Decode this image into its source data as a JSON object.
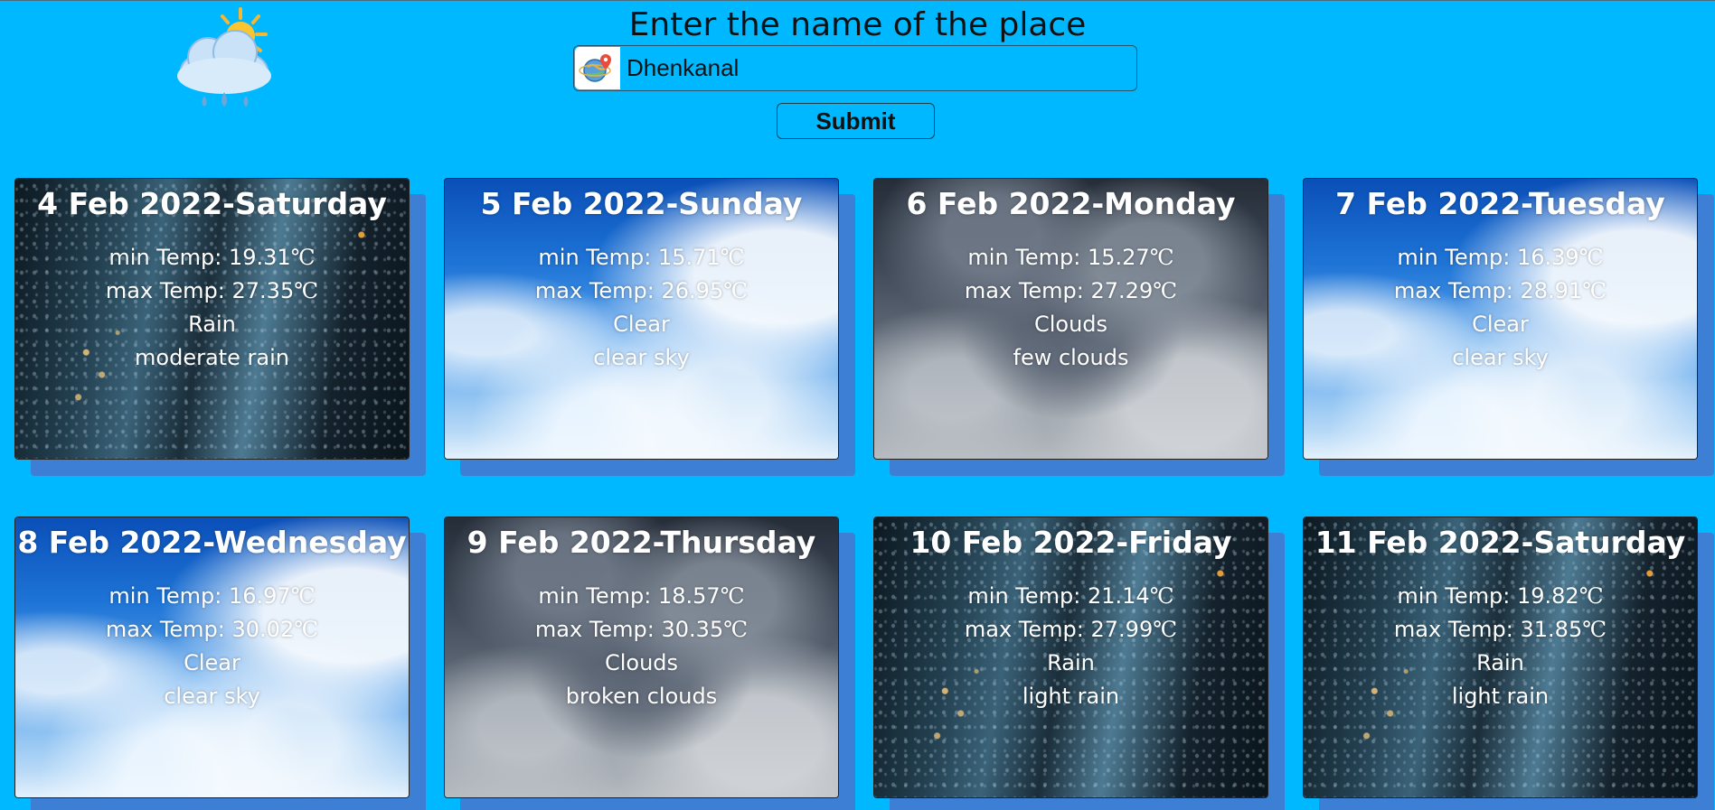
{
  "header": {
    "prompt": "Enter the name of the place",
    "search_value": "Dhenkanal",
    "submit_label": "Submit"
  },
  "labels": {
    "min_prefix": "min Temp: ",
    "max_prefix": "max Temp: ",
    "unit": "℃"
  },
  "colors": {
    "page_background": "#00b8ff",
    "card_shadow": "#3d7fd4"
  },
  "icons": {
    "logo": "sun-behind-rain-cloud-icon",
    "search": "globe-location-pin-icon"
  },
  "forecast": [
    {
      "date": "4 Feb 2022-Saturday",
      "min": "19.31",
      "max": "27.35",
      "main": "Rain",
      "description": "moderate rain",
      "background": "rain"
    },
    {
      "date": "5 Feb 2022-Sunday",
      "min": "15.71",
      "max": "26.95",
      "main": "Clear",
      "description": "clear sky",
      "background": "clear"
    },
    {
      "date": "6 Feb 2022-Monday",
      "min": "15.27",
      "max": "27.29",
      "main": "Clouds",
      "description": "few clouds",
      "background": "clouds"
    },
    {
      "date": "7 Feb 2022-Tuesday",
      "min": "16.39",
      "max": "28.91",
      "main": "Clear",
      "description": "clear sky",
      "background": "clear"
    },
    {
      "date": "8 Feb 2022-Wednesday",
      "min": "16.97",
      "max": "30.02",
      "main": "Clear",
      "description": "clear sky",
      "background": "clear"
    },
    {
      "date": "9 Feb 2022-Thursday",
      "min": "18.57",
      "max": "30.35",
      "main": "Clouds",
      "description": "broken clouds",
      "background": "clouds"
    },
    {
      "date": "10 Feb 2022-Friday",
      "min": "21.14",
      "max": "27.99",
      "main": "Rain",
      "description": "light rain",
      "background": "rain"
    },
    {
      "date": "11 Feb 2022-Saturday",
      "min": "19.82",
      "max": "31.85",
      "main": "Rain",
      "description": "light rain",
      "background": "rain"
    }
  ]
}
